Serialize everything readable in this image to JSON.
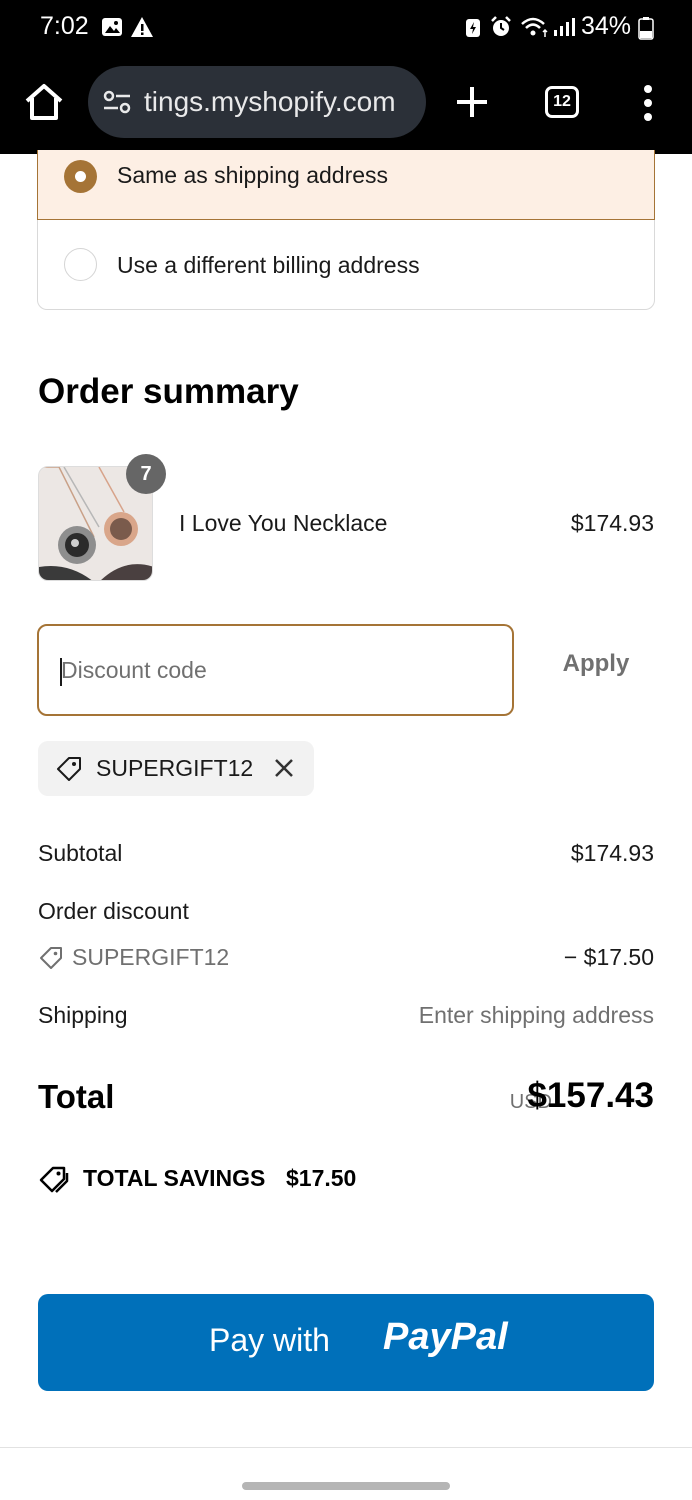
{
  "status_bar": {
    "time": "7:02",
    "battery": "34%"
  },
  "browser": {
    "url": "tings.myshopify.com",
    "tab_count": "12"
  },
  "billing": {
    "options": [
      {
        "label": "Same as shipping address",
        "selected": true
      },
      {
        "label": "Use a different billing address",
        "selected": false
      }
    ]
  },
  "order_summary": {
    "title": "Order summary",
    "item": {
      "name": "I Love You Necklace",
      "price": "$174.93",
      "quantity": "7"
    },
    "discount": {
      "placeholder": "Discount code",
      "apply_label": "Apply",
      "applied_code": "SUPERGIFT12"
    },
    "rows": {
      "subtotal_label": "Subtotal",
      "subtotal_value": "$174.93",
      "order_discount_label": "Order discount",
      "discount_code": "SUPERGIFT12",
      "discount_value": "− $17.50",
      "shipping_label": "Shipping",
      "shipping_value": "Enter shipping address"
    },
    "total": {
      "label": "Total",
      "currency": "USD",
      "value": "$157.43"
    },
    "savings": {
      "label": "TOTAL SAVINGS",
      "value": "$17.50"
    }
  },
  "paypal_button": {
    "prefix": "Pay with",
    "brand": "PayPal"
  },
  "colors": {
    "accent": "#a57436",
    "selected_bg": "#fdefe4",
    "paypal_blue": "#0070ba"
  }
}
